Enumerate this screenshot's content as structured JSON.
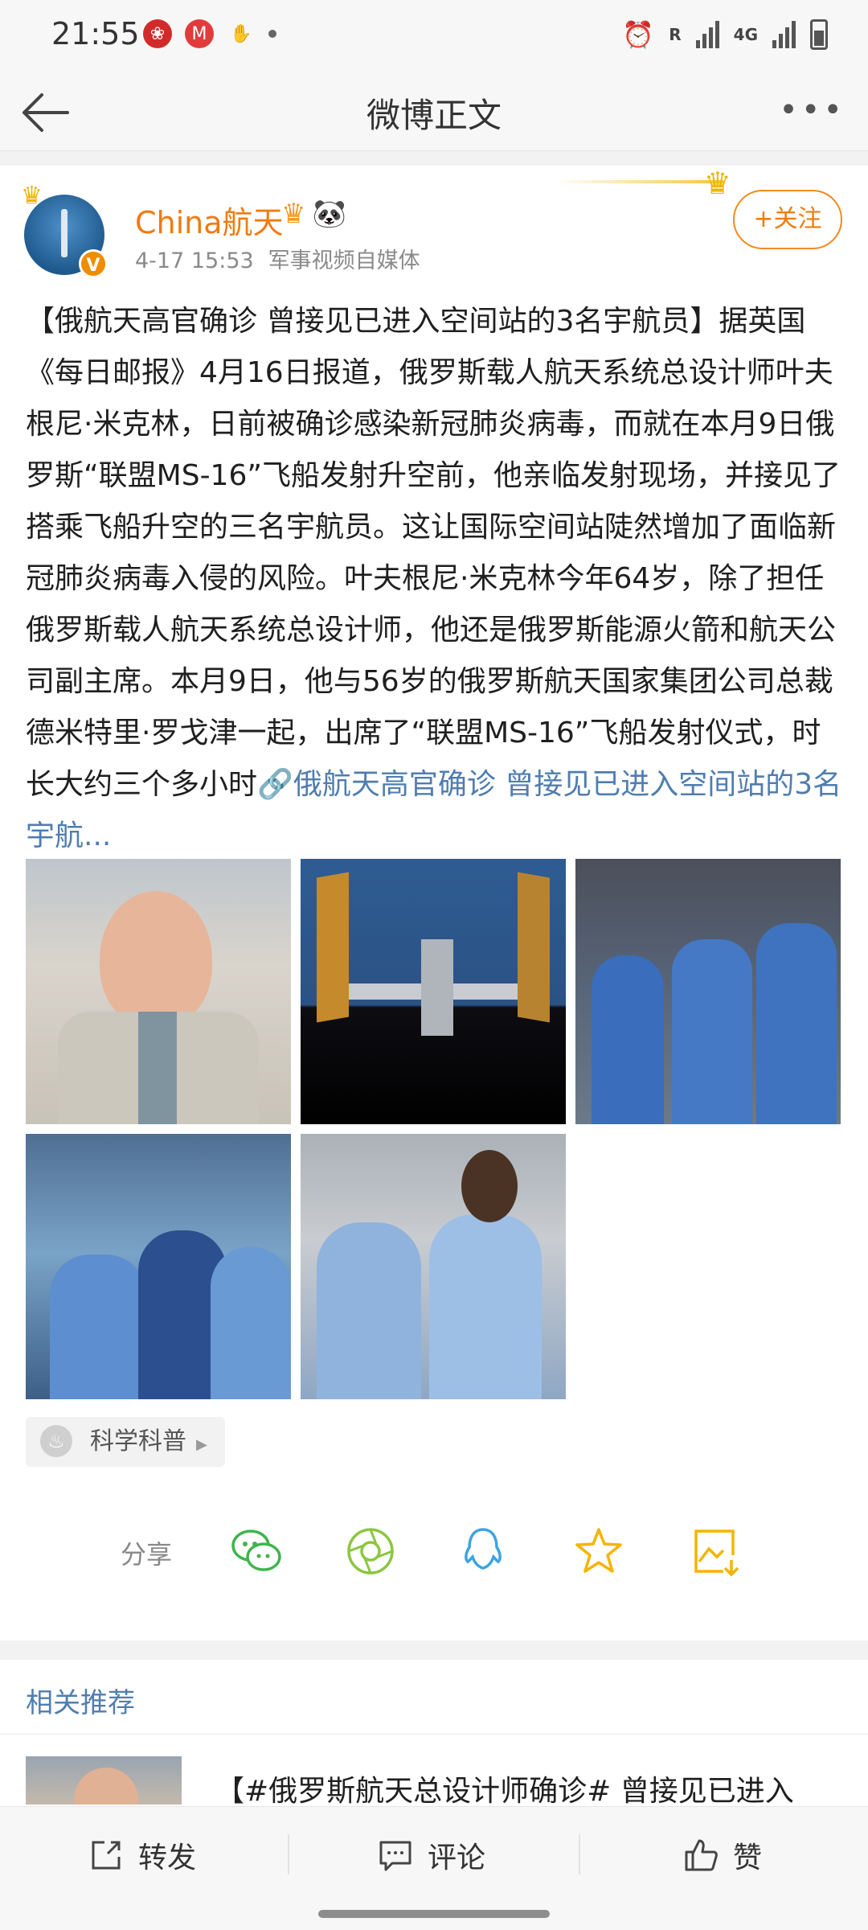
{
  "status_bar": {
    "time": "21:55",
    "signal_label": "4G",
    "roaming_label": "R"
  },
  "nav": {
    "title": "微博正文"
  },
  "post": {
    "author": "China航天",
    "timestamp": "4-17 15:53",
    "source": "军事视频自媒体",
    "follow_label": "+关注",
    "verified_badge": "V",
    "text": "【俄航天高官确诊 曾接见已进入空间站的3名宇航员】据英国《每日邮报》4月16日报道，俄罗斯载人航天系统总设计师叶夫根尼·米克林，日前被确诊感染新冠肺炎病毒，而就在本月9日俄罗斯“联盟MS-16”飞船发射升空前，他亲临发射现场，并接见了搭乘飞船升空的三名宇航员。这让国际空间站陡然增加了面临新冠肺炎病毒入侵的风险。叶夫根尼·米克林今年64岁，除了担任俄罗斯载人航天系统总设计师，他还是俄罗斯能源火箭和航天公司副主席。本月9日，他与56岁的俄罗斯航天国家集团公司总裁德米特里·罗戈津一起，出席了“联盟MS-16”飞船发射仪式，时长大约三个多小时",
    "link_text": "俄航天高官确诊 曾接见已进入空间站的3名宇航...",
    "topic_tag": "科学科普"
  },
  "share": {
    "label": "分享"
  },
  "related": {
    "title": "相关推荐",
    "first_item_text": "【#俄罗斯航天总设计师确诊# 曾接见已进入"
  },
  "bottom_bar": {
    "repost_label": "转发",
    "comment_label": "评论",
    "like_label": "赞"
  },
  "colors": {
    "accent_orange": "#f07b0f",
    "link_blue": "#507daf",
    "wechat_green": "#3fb44b",
    "moments_green": "#8cc63f",
    "qq_blue": "#3ba4e0",
    "favorite_gold": "#f5b400"
  }
}
